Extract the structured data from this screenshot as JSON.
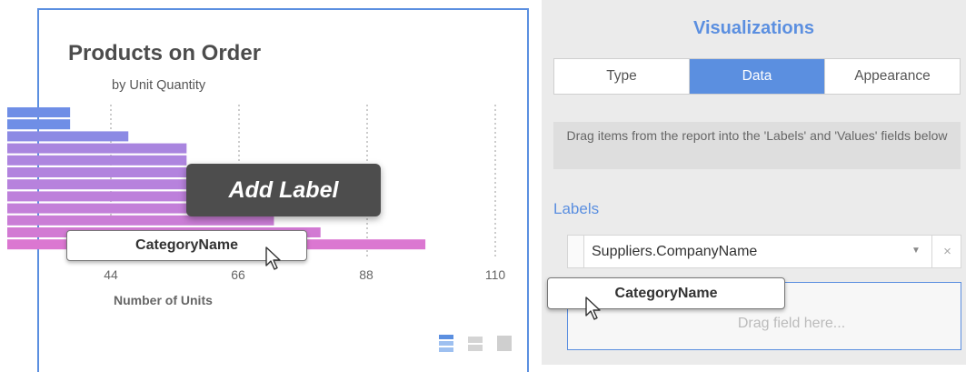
{
  "chart": {
    "title": "Products on Order",
    "subtitle": "by Unit Quantity",
    "x_ticks": [
      "44",
      "66",
      "88",
      "110"
    ],
    "xlabel": "Number of Units",
    "tooltip": "Add Label",
    "drag_chip": "CategoryName",
    "view_icons": [
      "grid-view-icon",
      "list-view-icon",
      "block-view-icon"
    ]
  },
  "chart_data": {
    "type": "bar",
    "orientation": "horizontal",
    "title": "Products on Order",
    "subtitle": "by Unit Quantity",
    "xlabel": "Number of Units",
    "x_ticks": [
      44,
      66,
      88,
      110
    ],
    "grid": true,
    "values": [
      37,
      37,
      47,
      57,
      57,
      57,
      57,
      57,
      67,
      72,
      80,
      98
    ],
    "colors": [
      "#6f8ee6",
      "#6f8ee6",
      "#8c8ae4",
      "#a985df",
      "#ae85df",
      "#b283de",
      "#b782dd",
      "#bd80db",
      "#c37fd9",
      "#ca7dd6",
      "#d27ad3",
      "#db77d1"
    ]
  },
  "panel": {
    "title": "Visualizations",
    "tabs": [
      {
        "label": "Type",
        "active": false
      },
      {
        "label": "Data",
        "active": true
      },
      {
        "label": "Appearance",
        "active": false
      }
    ],
    "help_text": "Drag items from the report into the 'Labels' and 'Values' fields below",
    "labels_heading": "Labels",
    "label_field": {
      "value": "Suppliers.CompanyName",
      "dropdown": "▼",
      "clear": "×"
    },
    "drag_chip": "CategoryName",
    "drop_placeholder": "Drag field here..."
  },
  "colors": {
    "accent": "#5b8fe0",
    "panel_bg": "#ebebeb",
    "tooltip_bg": "#4d4d4d"
  }
}
